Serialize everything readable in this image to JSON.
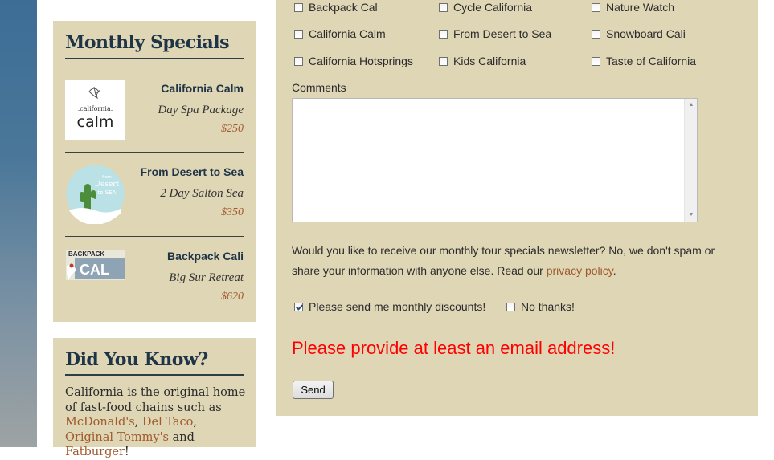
{
  "specials": {
    "title": "Monthly Specials",
    "items": [
      {
        "name": "California Calm",
        "desc": "Day Spa Package",
        "price": "$250",
        "logo_top": ".california.",
        "logo_main": "calm"
      },
      {
        "name": "From Desert to Sea",
        "desc": "2 Day Salton Sea",
        "price": "$350",
        "logo_top": "from",
        "logo_main": "Desert",
        "logo_sub": "to SEA"
      },
      {
        "name": "Backpack Cali",
        "desc": "Big Sur Retreat",
        "price": "$620",
        "logo_top": "BACKPACK",
        "logo_main": "CAL"
      }
    ]
  },
  "didyouknow": {
    "title": "Did You Know?",
    "text_before": "California is the original home of fast-food chains such as ",
    "link1": "McDonald's",
    "sep1": ", ",
    "link2": "Del Taco",
    "sep2": ", ",
    "link3": "Original Tommy's",
    "sep3": " and ",
    "link4": "Fatburger",
    "text_end": "!"
  },
  "form": {
    "tours": [
      {
        "label": "Backpack Cal",
        "checked": false
      },
      {
        "label": "Cycle California",
        "checked": false
      },
      {
        "label": "Nature Watch",
        "checked": false
      },
      {
        "label": "California Calm",
        "checked": false
      },
      {
        "label": "From Desert to Sea",
        "checked": false
      },
      {
        "label": "Snowboard Cali",
        "checked": false
      },
      {
        "label": "California Hotsprings",
        "checked": false
      },
      {
        "label": "Kids California",
        "checked": false
      },
      {
        "label": "Taste of California",
        "checked": false
      }
    ],
    "comments_label": "Comments",
    "comments_value": "",
    "newsletter_text": "Would you like to receive our monthly tour specials newsletter? No, we don't spam or share your information with anyone else. Read our ",
    "privacy_link": "privacy policy",
    "newsletter_end": ".",
    "opt_discounts": {
      "label": "Please send me monthly discounts!",
      "checked": true
    },
    "opt_nothanks": {
      "label": "No thanks!",
      "checked": false
    },
    "error": "Please provide at least an email address!",
    "send_label": "Send"
  },
  "colors": {
    "panel_bg": "#dfd6b6",
    "heading": "#1f3446",
    "link": "#a05a2c",
    "error": "#ff0000"
  }
}
